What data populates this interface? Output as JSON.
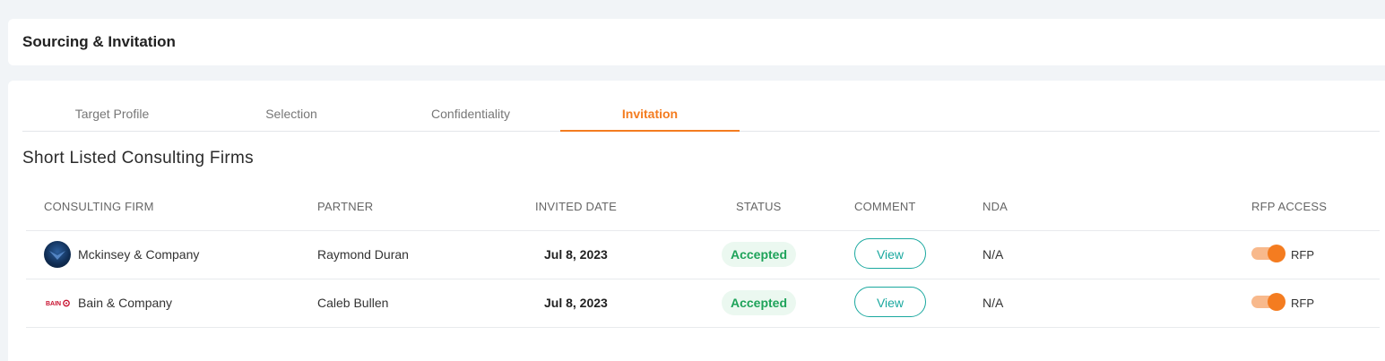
{
  "header": {
    "title": "Sourcing & Invitation"
  },
  "tabs": [
    {
      "label": "Target Profile",
      "active": false
    },
    {
      "label": "Selection",
      "active": false
    },
    {
      "label": "Confidentiality",
      "active": false
    },
    {
      "label": "Invitation",
      "active": true
    }
  ],
  "section_title": "Short Listed Consulting Firms",
  "table": {
    "headers": [
      "CONSULTING FIRM",
      "PARTNER",
      "INVITED DATE",
      "STATUS",
      "COMMENT",
      "NDA",
      "RFP ACCESS"
    ],
    "rows": [
      {
        "logo_icon": "mckinsey-logo-icon",
        "firm": "Mckinsey & Company",
        "partner": "Raymond Duran",
        "date": "Jul 8, 2023",
        "status": "Accepted",
        "comment_button": "View",
        "nda": "N/A",
        "rfp_access": true,
        "rfp_label": "RFP"
      },
      {
        "logo_icon": "bain-logo-icon",
        "logo_text": "BAIN",
        "firm": "Bain & Company",
        "partner": "Caleb Bullen",
        "date": "Jul 8, 2023",
        "status": "Accepted",
        "comment_button": "View",
        "nda": "N/A",
        "rfp_access": true,
        "rfp_label": "RFP"
      }
    ]
  },
  "colors": {
    "accent": "#f47c20",
    "teal": "#1aa89f",
    "success": "#1ea35a"
  }
}
